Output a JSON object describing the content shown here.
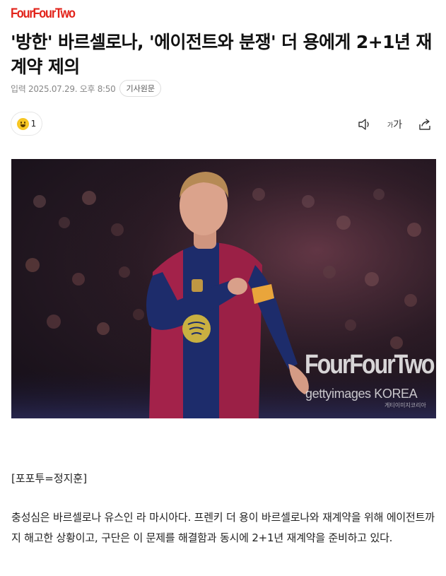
{
  "header": {
    "logo_text": "FourFourTwo"
  },
  "article": {
    "title": "'방한' 바르셀로나, '에이전트와 분쟁' 더 용에게 2+1년 재계약 제의",
    "date": "입력 2025.07.29. 오후 8:50",
    "source_button": "기사원문",
    "reaction": {
      "icon": "smile-emoji-icon",
      "count": "1"
    },
    "tools": {
      "font_label_small": "가",
      "font_label_large": "가"
    },
    "image": {
      "watermark": "FourFourTwo",
      "credit": "gettyimages KOREA",
      "credit_small": "게티이미지코리아"
    },
    "byline": "[포포투=정지훈]",
    "body": "충성심은 바르셀로나 유스인 라 마시아다. 프렌키 더 용이 바르셀로나와 재계약을 위해 에이전트까지 해고한 상황이고, 구단은 이 문제를 해결함과 동시에 2+1년 재계약을 준비하고 있다."
  },
  "colors": {
    "brand": "#e2231a",
    "jersey_blue": "#1d2c6b",
    "jersey_red": "#a3224a"
  }
}
